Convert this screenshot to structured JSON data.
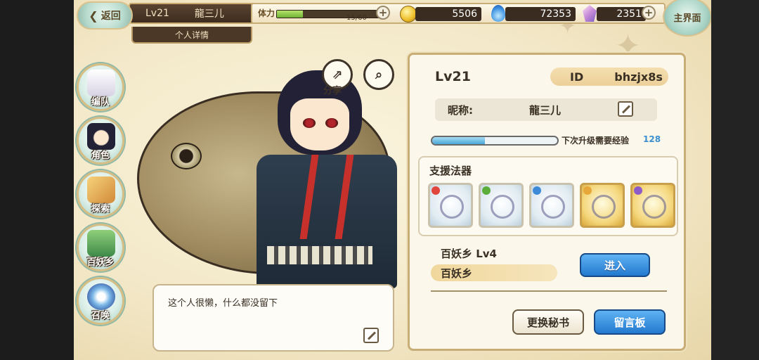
{
  "topbar": {
    "back_label": "返回",
    "level": "Lv21",
    "player_name": "龍三儿",
    "detail_tab": "个人详情",
    "stamina_label": "体力",
    "stamina_text": "15/60",
    "stamina_fraction": 0.25,
    "gold": "5506",
    "soul_fire": "72353",
    "crystal": "2351",
    "home_label": "主界面"
  },
  "menu": [
    {
      "label": "编队",
      "icon": "team-icon"
    },
    {
      "label": "角色",
      "icon": "character-icon"
    },
    {
      "label": "探索",
      "icon": "explore-icon"
    },
    {
      "label": "百妖乡",
      "icon": "village-icon"
    },
    {
      "label": "召唤",
      "icon": "summon-icon"
    }
  ],
  "tools": {
    "share_label": "分享"
  },
  "bio": {
    "text": "这个人很懒，什么都没留下"
  },
  "profile": {
    "level": "Lv21",
    "id_label": "ID",
    "id_value": "bhzjx8s",
    "nickname_label": "昵称:",
    "nickname_value": "龍三儿",
    "exp_label": "下次升级需要经验",
    "exp_value": "128",
    "exp_fraction": 0.42
  },
  "support": {
    "title": "支援法器",
    "relics": [
      {
        "name": "bracelet-relic",
        "frame": "silver",
        "gem_color": "#e0463c"
      },
      {
        "name": "feather-relic",
        "frame": "silver",
        "gem_color": "#5cae3a"
      },
      {
        "name": "armor-relic",
        "frame": "silver",
        "gem_color": "#3d8ad8"
      },
      {
        "name": "ring-relic",
        "frame": "gold",
        "gem_color": "#e6a83a"
      },
      {
        "name": "sword-relic",
        "frame": "gold",
        "gem_color": "#8d5cc8"
      }
    ]
  },
  "village": {
    "title": "百妖乡  Lv4",
    "name": "百妖乡",
    "enter_label": "进入"
  },
  "actions": {
    "change_secretary": "更换秘书",
    "message_board": "留言板"
  },
  "colors": {
    "accent_blue": "#2379cf",
    "panel_bg": "#fbf7ea",
    "frame_gold": "#c9ad76"
  }
}
